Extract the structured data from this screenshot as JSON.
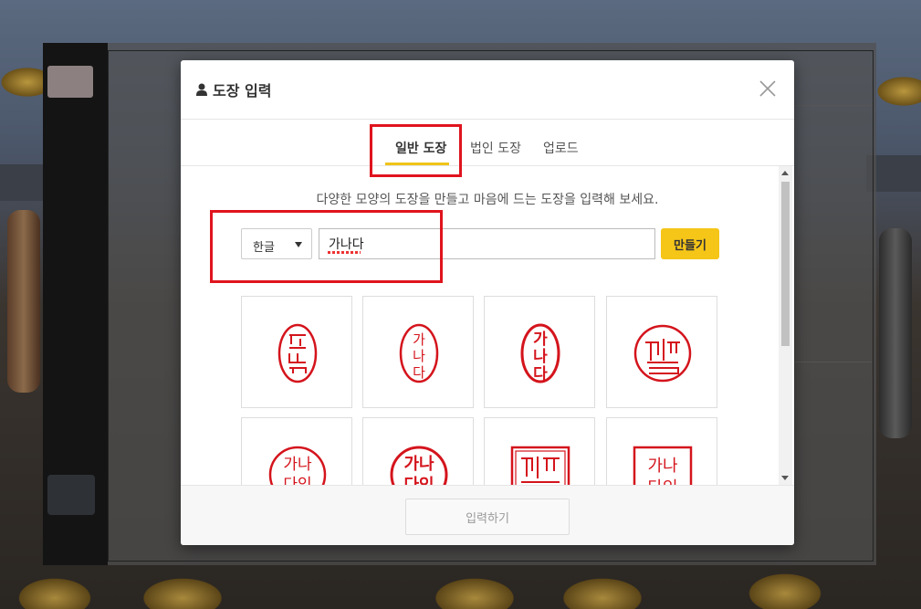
{
  "modal": {
    "title": "도장 입력",
    "close_label": "×"
  },
  "tabs": [
    {
      "label": "일반 도장",
      "active": true
    },
    {
      "label": "법인 도장",
      "active": false
    },
    {
      "label": "업로드",
      "active": false
    }
  ],
  "description": "다양한 모양의 도장을 만들고 마음에 드는 도장을 입력해 보세요.",
  "language_select": {
    "value": "한글"
  },
  "name_input": {
    "value": "가나다"
  },
  "make_button": {
    "label": "만들기"
  },
  "footer": {
    "submit_label": "입력하기"
  },
  "stamps": [
    {
      "style": "oval-seal-script",
      "text": "가나다"
    },
    {
      "style": "oval-plain",
      "text": "가나다"
    },
    {
      "style": "oval-bold",
      "text": "가나다"
    },
    {
      "style": "circle-seal-script",
      "text": "가나다"
    },
    {
      "style": "circle-plain",
      "text": "가나다인"
    },
    {
      "style": "circle-bold",
      "text": "가나다인"
    },
    {
      "style": "square-seal-script",
      "text": "가나다"
    },
    {
      "style": "square-plain",
      "text": "가나다인"
    }
  ],
  "colors": {
    "accent": "#f5c518",
    "stamp": "#d4141c",
    "highlight": "#e0141e"
  }
}
